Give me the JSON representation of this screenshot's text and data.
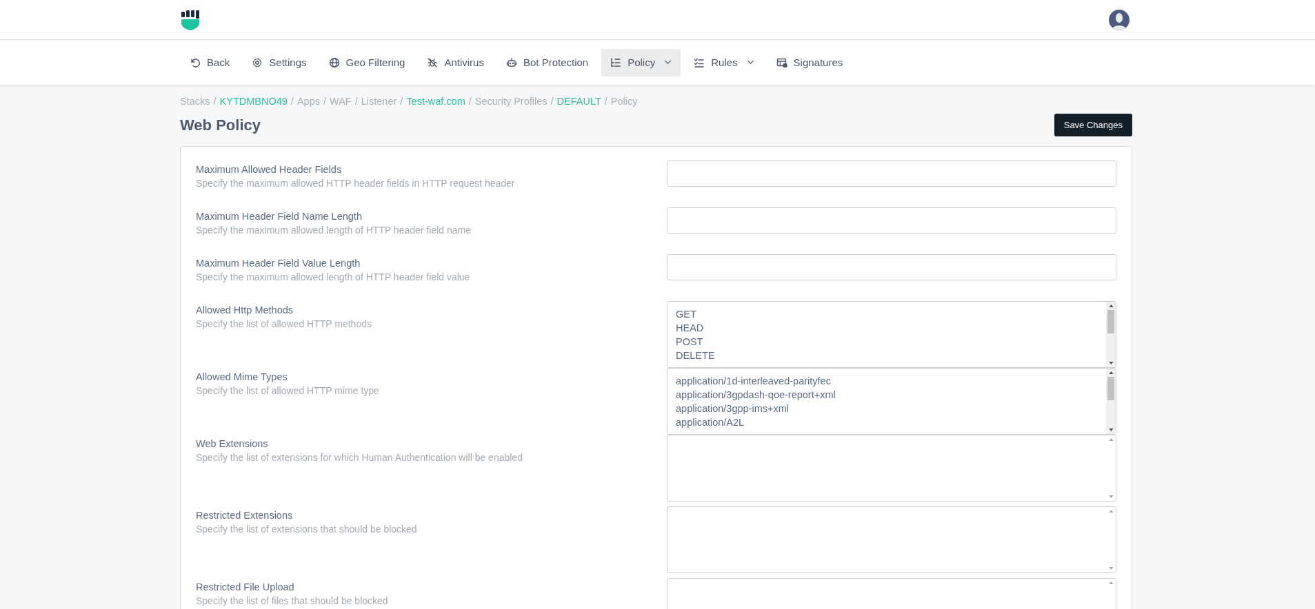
{
  "nav": [
    {
      "label": "Back",
      "selected": false,
      "dropdown": false
    },
    {
      "label": "Settings",
      "selected": false,
      "dropdown": false
    },
    {
      "label": "Geo Filtering",
      "selected": false,
      "dropdown": false
    },
    {
      "label": "Antivirus",
      "selected": false,
      "dropdown": false
    },
    {
      "label": "Bot Protection",
      "selected": false,
      "dropdown": false
    },
    {
      "label": "Policy",
      "selected": true,
      "dropdown": true
    },
    {
      "label": "Rules",
      "selected": false,
      "dropdown": true
    },
    {
      "label": "Signatures",
      "selected": false,
      "dropdown": false
    }
  ],
  "breadcrumb": [
    {
      "label": "Stacks",
      "link": false
    },
    {
      "label": "KYTDMBNO49",
      "link": true
    },
    {
      "label": "Apps",
      "link": false
    },
    {
      "label": "WAF",
      "link": false
    },
    {
      "label": "Listener",
      "link": false
    },
    {
      "label": "Test-waf.com",
      "link": true
    },
    {
      "label": "Security Profiles",
      "link": false
    },
    {
      "label": "DEFAULT",
      "link": true
    },
    {
      "label": "Policy",
      "link": false
    }
  ],
  "breadcrumb_separator": "/",
  "title": "Web Policy",
  "save_button": "Save Changes",
  "fields": [
    {
      "kind": "input",
      "label": "Maximum Allowed Header Fields",
      "description": "Specify the maximum allowed HTTP header fields in HTTP request header"
    },
    {
      "kind": "input",
      "label": "Maximum Header Field Name Length",
      "description": "Specify the maximum allowed length of HTTP header field name"
    },
    {
      "kind": "input",
      "label": "Maximum Header Field Value Length",
      "description": "Specify the maximum allowed length of HTTP header field value"
    },
    {
      "kind": "listbox",
      "label": "Allowed Http Methods",
      "description": "Specify the list of allowed HTTP methods",
      "options": [
        "GET",
        "HEAD",
        "POST",
        "DELETE"
      ]
    },
    {
      "kind": "listbox",
      "label": "Allowed Mime Types",
      "description": "Specify the list of allowed HTTP mime type",
      "options": [
        "application/1d-interleaved-parityfec",
        "application/3gpdash-qoe-report+xml",
        "application/3gpp-ims+xml",
        "application/A2L"
      ]
    },
    {
      "kind": "textarea",
      "label": "Web Extensions",
      "description": "Specify the list of extensions for which Human Authentication will be enabled"
    },
    {
      "kind": "textarea",
      "label": "Restricted Extensions",
      "description": "Specify the list of extensions that should be blocked"
    },
    {
      "kind": "textarea",
      "label": "Restricted File Upload",
      "description": "Specify the list of files that should be blocked"
    }
  ]
}
